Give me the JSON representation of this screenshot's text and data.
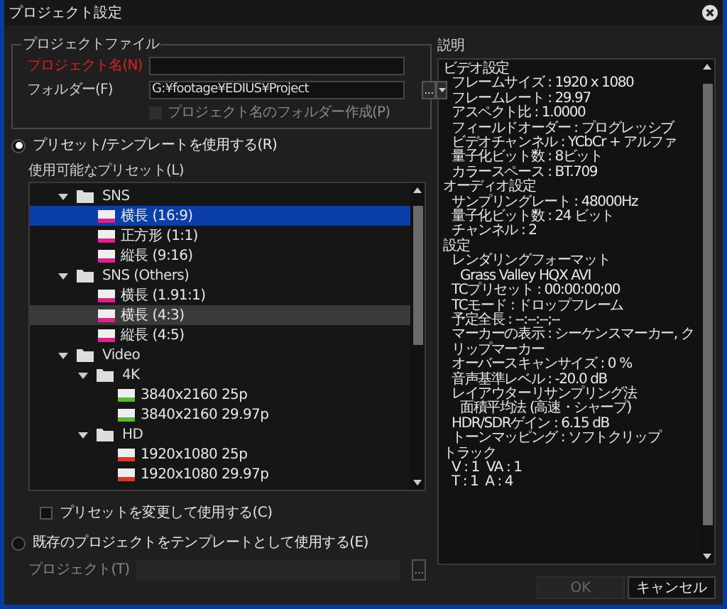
{
  "window": {
    "title": "プロジェクト設定"
  },
  "project_file": {
    "legend": "プロジェクトファイル",
    "name_label": "プロジェクト名(N)",
    "name_required": true,
    "folder_label": "フォルダー(F)",
    "folder_value": "G:¥footage¥EDIUS¥Project",
    "browse_button": "...",
    "create_folder": {
      "label": "プロジェクト名のフォルダー作成(P)",
      "checked": false,
      "disabled": true
    }
  },
  "use_preset": {
    "label": "プリセット/テンプレートを使用する(R)",
    "selected": true
  },
  "presets": {
    "label": "使用可能なプリセット(L)",
    "items": [
      {
        "kind": "folder",
        "label": "SNS",
        "expanded": true,
        "children": [
          {
            "kind": "preset",
            "color": "#e0208c",
            "label": "横長 (16:9)",
            "selected": true,
            "hovered": false
          },
          {
            "kind": "preset",
            "color": "#e0208c",
            "label": "正方形 (1:1)",
            "selected": false,
            "hovered": false
          },
          {
            "kind": "preset",
            "color": "#e0208c",
            "label": "縦長 (9:16)",
            "selected": false,
            "hovered": false
          }
        ]
      },
      {
        "kind": "folder",
        "label": "SNS (Others)",
        "expanded": true,
        "children": [
          {
            "kind": "preset",
            "color": "#e0208c",
            "label": "横長 (1.91:1)",
            "selected": false,
            "hovered": false
          },
          {
            "kind": "preset",
            "color": "#e0208c",
            "label": "横長 (4:3)",
            "selected": false,
            "hovered": true
          },
          {
            "kind": "preset",
            "color": "#e0208c",
            "label": "縦長 (4:5)",
            "selected": false,
            "hovered": false
          }
        ]
      },
      {
        "kind": "folder",
        "label": "Video",
        "expanded": true,
        "children": [
          {
            "kind": "folder",
            "label": "4K",
            "expanded": true,
            "children": [
              {
                "kind": "preset",
                "color": "#5cb82e",
                "label": "3840x2160 25p",
                "selected": false,
                "hovered": false
              },
              {
                "kind": "preset",
                "color": "#5cb82e",
                "label": "3840x2160 29.97p",
                "selected": false,
                "hovered": false
              }
            ]
          },
          {
            "kind": "folder",
            "label": "HD",
            "expanded": true,
            "children": [
              {
                "kind": "preset",
                "color": "#d83a2a",
                "label": "1920x1080 25p",
                "selected": false,
                "hovered": false
              },
              {
                "kind": "preset",
                "color": "#d83a2a",
                "label": "1920x1080 29.97p",
                "selected": false,
                "hovered": false
              }
            ]
          }
        ]
      }
    ]
  },
  "modify_preset": {
    "label": "プリセットを変更して使用する(C)",
    "checked": false
  },
  "use_existing": {
    "label": "既存のプロジェクトをテンプレートとして使用する(E)",
    "selected": false
  },
  "template_project": {
    "label": "プロジェクト(T)",
    "browse_button": "...",
    "disabled": true
  },
  "description": {
    "label": "説明",
    "lines": [
      {
        "text": "ビデオ設定",
        "children": [
          {
            "text": "フレームサイズ : 1920 x 1080"
          },
          {
            "text": "フレームレート : 29.97"
          },
          {
            "text": "アスペクト比 : 1.0000"
          },
          {
            "text": "フィールドオーダー : プログレッシブ"
          },
          {
            "text": "ビデオチャンネル : YCbCr + アルファ"
          },
          {
            "text": "量子化ビット数 : 8ビット"
          },
          {
            "text": "カラースペース : BT.709"
          }
        ]
      },
      {
        "text": "オーディオ設定",
        "children": [
          {
            "text": "サンプリングレート : 48000Hz"
          },
          {
            "text": "量子化ビット数 : 24 ビット"
          },
          {
            "text": "チャンネル : 2"
          }
        ]
      },
      {
        "text": "設定",
        "children": [
          {
            "text": "レンダリングフォーマット",
            "children": [
              {
                "text": "Grass Valley HQX AVI"
              }
            ]
          },
          {
            "text": "TCプリセット : 00:00:00;00"
          },
          {
            "text": "TCモード : ドロップフレーム"
          },
          {
            "text": "予定全長 : --:--:--;--"
          },
          {
            "text": "マーカーの表示 : シーケンスマーカー, クリップマーカー"
          },
          {
            "text": "オーバースキャンサイズ : 0 %"
          },
          {
            "text": "音声基準レベル : -20.0 dB"
          },
          {
            "text": "レイアウターリサンプリング法",
            "children": [
              {
                "text": "面積平均法 (高速・シャープ)"
              }
            ]
          },
          {
            "text": "HDR/SDRゲイン : 6.15 dB"
          },
          {
            "text": "トーンマッピング : ソフトクリップ"
          }
        ]
      },
      {
        "text": "トラック",
        "children": [
          {
            "text": "V : 1  VA : 1"
          },
          {
            "text": "T : 1  A : 4"
          }
        ]
      }
    ]
  },
  "buttons": [
    {
      "label": "OK",
      "disabled": true
    },
    {
      "label": "キャンセル",
      "disabled": false
    }
  ]
}
